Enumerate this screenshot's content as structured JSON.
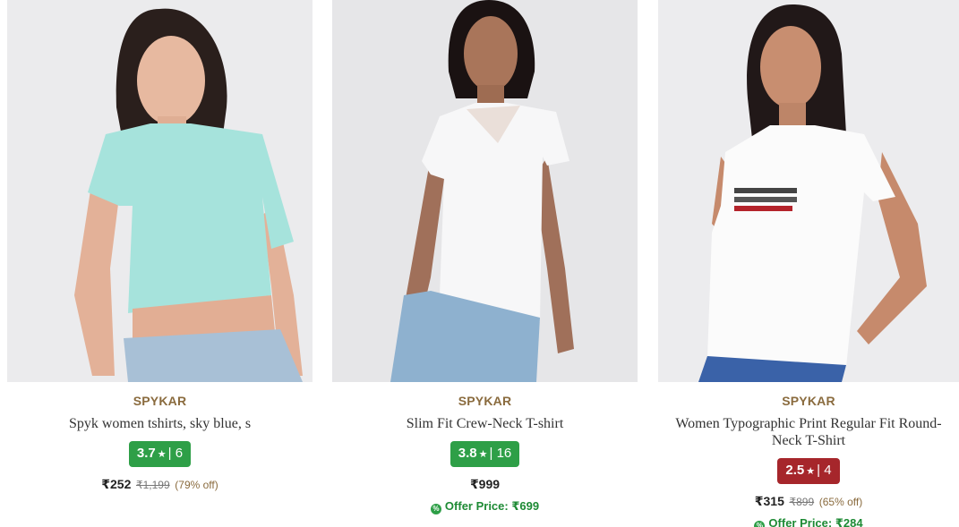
{
  "products": [
    {
      "image_alt": "Woman in sky blue knotted crop t-shirt",
      "brand": "SPYKAR",
      "name": "Spyk women tshirts, sky blue, s",
      "rating": "3.7",
      "rating_count": "6",
      "rating_color": "#2e9f47",
      "price": "₹252",
      "mrp": "₹1,199",
      "discount": "(79% off)",
      "offer": ""
    },
    {
      "image_alt": "Woman in white slim fit crew-neck t-shirt with mesh yoke",
      "brand": "SPYKAR",
      "name": "Slim Fit Crew-Neck T-shirt",
      "rating": "3.8",
      "rating_count": "16",
      "rating_color": "#2e9f47",
      "price": "₹999",
      "mrp": "",
      "discount": "",
      "offer": "Offer Price: ₹699"
    },
    {
      "image_alt": "Woman in white typographic print t-shirt",
      "brand": "SPYKAR",
      "name": "Women Typographic Print Regular Fit Round-Neck T-Shirt",
      "rating": "2.5",
      "rating_count": "4",
      "rating_color": "#a6262b",
      "price": "₹315",
      "mrp": "₹899",
      "discount": "(65% off)",
      "offer": "Offer Price: ₹284"
    }
  ],
  "icons": {
    "star": "★",
    "offer_badge": "%"
  }
}
